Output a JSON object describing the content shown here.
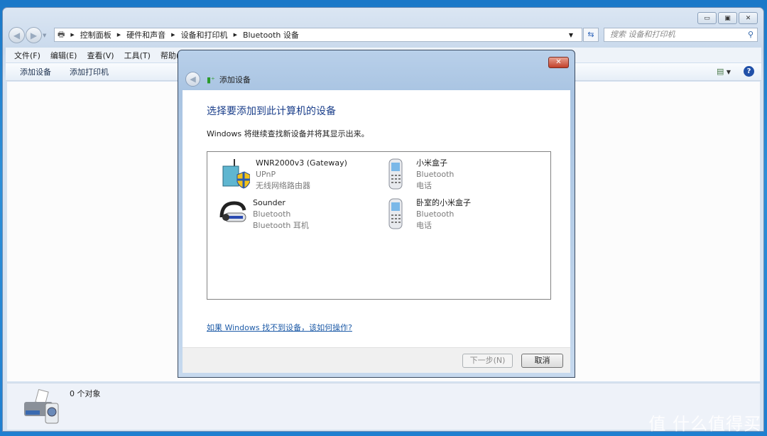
{
  "explorer": {
    "breadcrumb": [
      "控制面板",
      "硬件和声音",
      "设备和打印机",
      "Bluetooth 设备"
    ],
    "search_placeholder": "搜索 设备和打印机",
    "menu": [
      "文件(F)",
      "编辑(E)",
      "查看(V)",
      "工具(T)",
      "帮助(H)"
    ],
    "toolbar": {
      "add_device": "添加设备",
      "add_printer": "添加打印机"
    },
    "status": "0 个对象"
  },
  "dialog": {
    "title": "添加设备",
    "heading": "选择要添加到此计算机的设备",
    "subtext": "Windows 将继续查找新设备并将其显示出来。",
    "devices": [
      {
        "name": "WNR2000v3 (Gateway)",
        "protocol": "UPnP",
        "type": "无线网络路由器",
        "icon": "router-icon"
      },
      {
        "name": "小米盒子",
        "protocol": "Bluetooth",
        "type": "电话",
        "icon": "phone-icon"
      },
      {
        "name": "Sounder",
        "protocol": "Bluetooth",
        "type": "Bluetooth 耳机",
        "icon": "headset-icon"
      },
      {
        "name": "卧室的小米盒子",
        "protocol": "Bluetooth",
        "type": "电话",
        "icon": "phone-icon"
      }
    ],
    "help_link": "如果 Windows 找不到设备，该如何操作?",
    "next_label": "下一步(N)",
    "cancel_label": "取消"
  },
  "watermark": "值 什么值得买"
}
